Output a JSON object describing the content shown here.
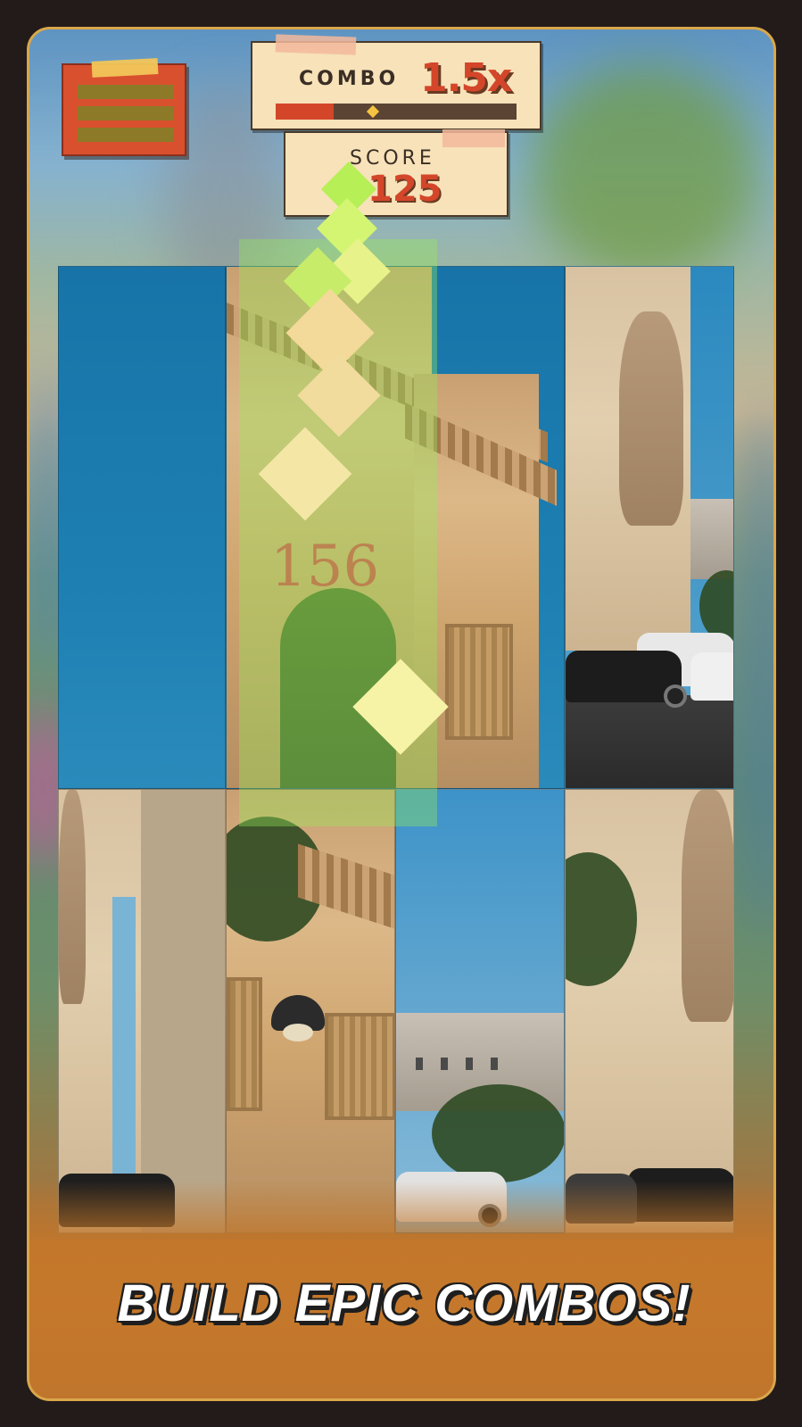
{
  "hud": {
    "menu_icon": "hamburger-menu-icon",
    "combo_label": "COMBO",
    "combo_value": "1.5x",
    "combo_progress": 0.24,
    "score_label": "SCORE",
    "score_value": "125"
  },
  "board": {
    "rows": 2,
    "columns": 4,
    "image_subject": "Arc de Triomphe",
    "ghost_text": "156"
  },
  "banner": {
    "text": "BUILD EPIC COMBOS!"
  },
  "colors": {
    "accent_red": "#d4462a",
    "panel": "#f7e2b9",
    "banner": "#c3772a",
    "frame_border": "#d9a74a",
    "highlight": "#96eb5a"
  }
}
